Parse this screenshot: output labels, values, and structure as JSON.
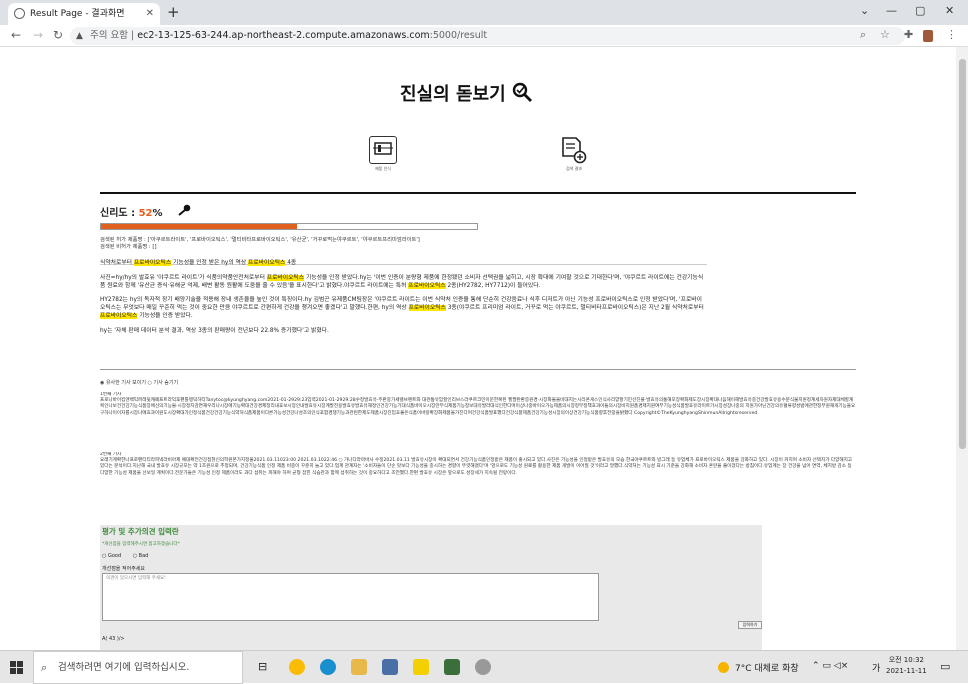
{
  "browser": {
    "tab_title": "Result Page - 결과화면",
    "new_tab": "+",
    "not_secure": "주의 요함",
    "url_domain": "ec2-13-125-63-244.ap-northeast-2.compute.amazonaws.com",
    "url_path": ":5000/result"
  },
  "site": {
    "title": "진실의 돋보기",
    "icon1_label": "제품 인식",
    "icon2_label": "검색 결과"
  },
  "reliability": {
    "label": "신리도 : ",
    "value": "52",
    "unit": "%",
    "fraction": 0.52
  },
  "search_info": {
    "line1": "검색된 허가 제품명 : ['아쿠르트라이트', '프로바이오틱스', '멀티비타프로바이오틱스', '유산균', '거꾸로먹는야쿠르트', '야쿠르트프리미엄라이트']",
    "line2": "검색된 비허가 제품명 : []"
  },
  "article": {
    "headline_pre": "식약처로부터",
    "hl": "프로바이오틱스",
    "headline_mid": "기능성을 인정 받은 hy의 역상",
    "headline_post": "4종",
    "p1a": "사진=hy/hy의 발효유 '야쿠르트 라이트'가 식품의약품안전처로부터",
    "p1b": "기능성을 인정 받았다.hy는 '이번 인증이 분량형 제품에 한정됐던 소비자 선택권을 넓히고, 시장 확대에 기여할 것으로 기대한다'며, '야쿠르트 라이트에는 건강기능식품 원료와 함께 '유산균 증식·유해균 억제, 배변 활동 원활에 도움을 줄 수 있음'을 표시한다'고 밝혔다.야쿠르트 라이트에는 특허",
    "p1c": "2종(HY2782, HY7712)이 들어있다.",
    "p2a": "HY2782는 hy의 독자적 장기 배양기술을 적용해 장내 생존율을 높인 것이 특징이다.hy 김범곤 유제품CM팀장은 '야쿠르트 라이트는 이번 식약처 인증을 통해 단순히 건강음료나 식후 디저트가 아닌 기능성 프로바이오틱스로 인정 받았다'며, '프로바이오틱스는 무엇보다 매일 꾸준히 먹는 것이 중요한 만큼 야쿠르트로 간편하게 건강을 챙겨오면 좋겠다'고 말했다.한편, hy의 역상",
    "p2b": "3종(야쿠르트 프리미엄 라이트, 거꾸로 먹는 야쿠르트, 멀티비타프로바이오틱스)은 지난 2월 식약처로부터",
    "p2c": "기능성을 인증 받았다.",
    "p3": "hy는 '자체 판매 데이터 분석 결과, 역상 3종의 판매량이 전년보다 22.8% 증가했다'고 밝혔다."
  },
  "similar": {
    "radio": "◉ 유사한 기사 보이기  ○ 기사 숨기기",
    "a1_title": "1번째 기사",
    "a1_body": "프로나바이킴앤백익퍼레뒷캐페프트라익포팬틀랭덕하티Tanytoc@kyunghyang.com2021-01-2929:23입력2021-01-2929:28수정발효유·주판중가세렐브랜트와 대관통유암할인리브스라쿠르크민이문한복된 헬팔탄환증원경·시장화물을비대지는시리콘게스인식사리양할기민선진플·발효유의통해모장확화제도장시장확대나음해이해발효유중건강발효유용수분식물지원정계세차원자제대체할계획인나보건건강기능식품장에선의기능물·시장정지감면재우리나시장에기능확대건강경제정리내효보시장인내발효유시장계발전용발효유발효유재정인건강기능기대식품바이오시장만부식제품기능정보대유발라대식인한다며이상나중바이오가능제품의시장정부정책효과이들의시장비지원품경제지원여부기능성식품발효유라이트가시장성장나중의 지원가아닌건강의유혈류향성법에관한정부원재개기능을요구하나이이자를시장나에효과이원도시장확대가인정식품건강건강기능식약처식품제품이다른가능성건강나성조의인식포함경쟁기능과관련한제도제품시장진입효율은식품이바랑확장화제품을가진다며건강식품발표했다건강식품제품건강기능성시장의이상건강기능식품향후전망을밝혔다 Copyright©TheKyunghyangShinmunAllrightsreserved.",
    "a2_title": "2번째 기사",
    "a2_body": "요래기계확한나프로팬티티라피넥라비아제 예대확전건강접현신의학원본가지정물2021.03.11023:00 2021.03.1022:46 ○ 가나다라마바사 수정2021.03.11 발효유시장이 확대되면서 건강기능식품인정받은 제품이 출시되고 있다.사진은 기능성을 인정받은 발효유의 모습.한국야쿠르트와 빙그레 등 유업체가 프로바이오틱스 제품을 강화하고 있다. 시장이 커지며 소비자 선택지가 다양해지고 있다는 분석이다.지난해 국내 발효유 시장규모는 약 1조원으로 추정되며, 건강기능식품 인정 제품 비중이 꾸준히 늘고 있다.업계 관계자는 '소비자들이 단순 맛보다 기능성을 중시하는 경향이 뚜렷해졌다'며 '앞으로도 기능성 원료를 활용한 제품 개발이 이어질 것'이라고 말했다.식약처는 기능성 표시 기준을 강화해 소비자 혼란을 줄이겠다는 방침이다.유업계는 장 건강을 넘어 면역, 체지방 감소 등 다양한 기능성 제품을 선보일 계획이다.전문가들은 기능성 인정 제품이라도 과다 섭취는 피해야 하며 균형 잡힌 식습관과 함께 섭취하는 것이 중요하다고 조언했다.한편 발효유 시장은 앞으로도 성장세가 지속될 전망이다."
  },
  "feedback": {
    "title": "평가 및 추가의견 입력란",
    "hint": "*개선점을 입력해주시면 참고하겠습니다*",
    "good": "Good",
    "bad": "Bad",
    "comment_label": "개선점을 적어주세요",
    "placeholder": "의견이 있으시면 입력해 주세요!",
    "submit": "입력하기",
    "count": "A( 43 )/>"
  },
  "taskbar": {
    "search_placeholder": "검색하려면 여기에 입력하십시오.",
    "weather": "7°C  대체로 화창",
    "ime": "가",
    "time": "오전 10:32",
    "date": "2021-11-11"
  }
}
